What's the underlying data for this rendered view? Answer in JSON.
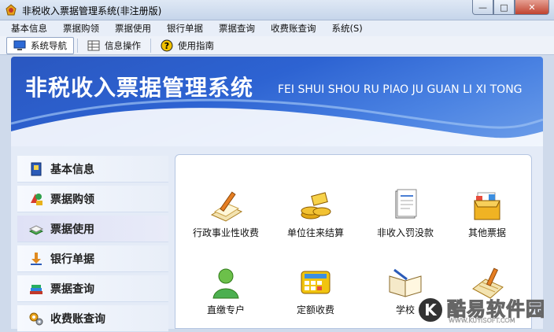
{
  "window": {
    "title": "非税收入票据管理系统(非注册版)"
  },
  "menu": [
    "基本信息",
    "票据购领",
    "票据使用",
    "银行单据",
    "票据查询",
    "收费账查询",
    "系统(S)"
  ],
  "toolbar": [
    {
      "label": "系统导航",
      "icon": "monitor-icon",
      "active": true
    },
    {
      "label": "信息操作",
      "icon": "grid-icon",
      "active": false
    },
    {
      "label": "使用指南",
      "icon": "help-icon",
      "active": false
    }
  ],
  "banner": {
    "title_cn": "非税收入票据管理系统",
    "title_en": "FEI SHUI SHOU RU PIAO JU GUAN LI XI TONG"
  },
  "nav": [
    {
      "label": "基本信息",
      "icon": "badge-icon"
    },
    {
      "label": "票据购领",
      "icon": "shapes-icon"
    },
    {
      "label": "票据使用",
      "icon": "book-icon",
      "active": true
    },
    {
      "label": "银行单据",
      "icon": "bank-download-icon"
    },
    {
      "label": "票据查询",
      "icon": "stack-books-icon"
    },
    {
      "label": "收费账查询",
      "icon": "gears-icon"
    }
  ],
  "features": [
    {
      "label": "行政事业性收费",
      "icon": "clipboard-pen-icon"
    },
    {
      "label": "单位往来结算",
      "icon": "gold-coins-icon"
    },
    {
      "label": "非收入罚没款",
      "icon": "document-icon"
    },
    {
      "label": "其他票据",
      "icon": "folder-box-icon"
    },
    {
      "label": "直缴专户",
      "icon": "user-icon"
    },
    {
      "label": "定额收费",
      "icon": "calculator-icon"
    },
    {
      "label": "学校",
      "icon": "open-book-icon"
    },
    {
      "label": "",
      "icon": "calendar-pen-icon"
    }
  ],
  "watermark": {
    "logo": "K",
    "name": "酷易软件园",
    "url": "WWW.KUYISOFT.COM"
  }
}
